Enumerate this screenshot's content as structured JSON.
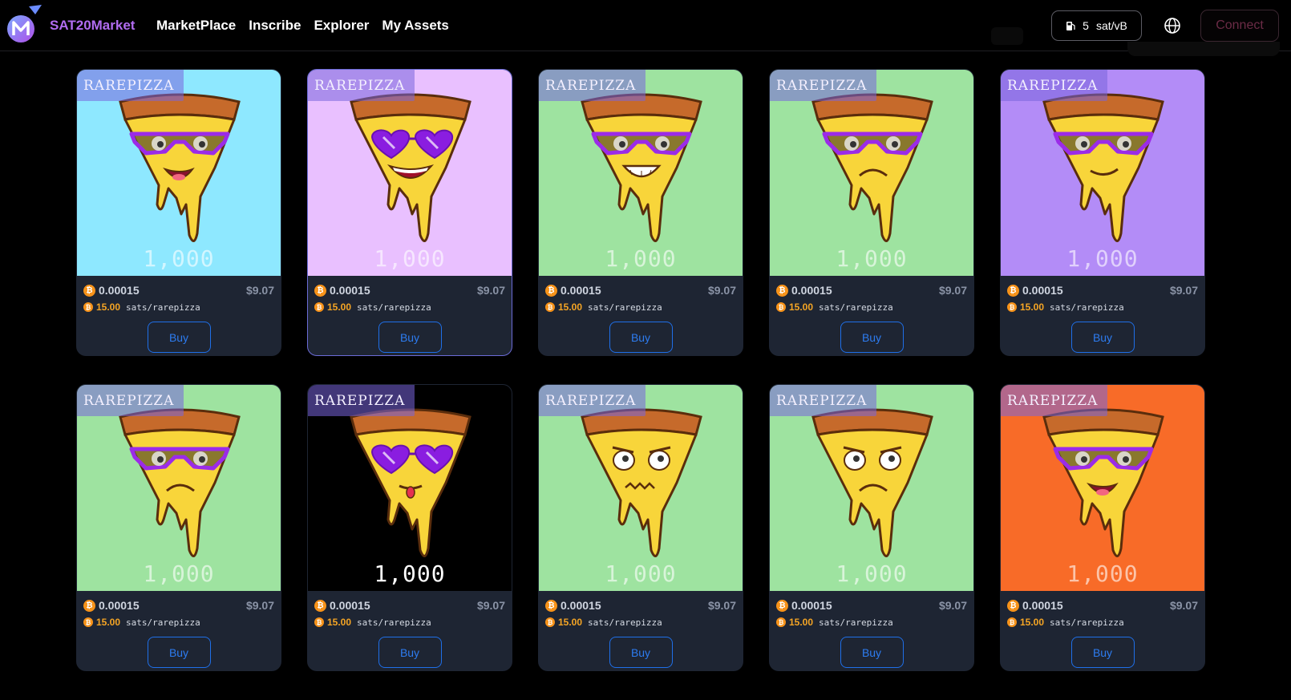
{
  "header": {
    "brand": "SAT20Market",
    "nav": [
      "MarketPlace",
      "Inscribe",
      "Explorer",
      "My Assets"
    ],
    "fee_value": "5",
    "fee_unit": "sat/vB",
    "connect_label": "Connect"
  },
  "colors": {
    "accent": "#b16cf0",
    "buy": "#2d7cf0",
    "rate": "#f5a524",
    "card": "#1e2533"
  },
  "icons": {
    "logo": "sat20-logo",
    "fee": "gas-pump-icon",
    "globe": "globe-icon",
    "coin": "bitcoin-icon"
  },
  "cards": [
    {
      "tag": "RAREPIZZA",
      "amount": "1,000",
      "price_btc": "0.00015",
      "price_usd": "$9.07",
      "rate": "15.00",
      "rate_unit": "sats/rarepizza",
      "buy": "Buy",
      "bg": "#8ee8ff",
      "mouth": "open",
      "glasses": "wide"
    },
    {
      "tag": "RAREPIZZA",
      "amount": "1,000",
      "price_btc": "0.00015",
      "price_usd": "$9.07",
      "rate": "15.00",
      "rate_unit": "sats/rarepizza",
      "buy": "Buy",
      "bg": "#e9c0ff",
      "mouth": "smile",
      "glasses": "heart"
    },
    {
      "tag": "RAREPIZZA",
      "amount": "1,000",
      "price_btc": "0.00015",
      "price_usd": "$9.07",
      "rate": "15.00",
      "rate_unit": "sats/rarepizza",
      "buy": "Buy",
      "bg": "#9ee3a0",
      "mouth": "grin",
      "glasses": "wide"
    },
    {
      "tag": "RAREPIZZA",
      "amount": "1,000",
      "price_btc": "0.00015",
      "price_usd": "$9.07",
      "rate": "15.00",
      "rate_unit": "sats/rarepizza",
      "buy": "Buy",
      "bg": "#9ee3a0",
      "mouth": "frown",
      "glasses": "wide"
    },
    {
      "tag": "RAREPIZZA",
      "amount": "1,000",
      "price_btc": "0.00015",
      "price_usd": "$9.07",
      "rate": "15.00",
      "rate_unit": "sats/rarepizza",
      "buy": "Buy",
      "bg": "#b38cf7",
      "mouth": "smirk",
      "glasses": "wide"
    },
    {
      "tag": "RAREPIZZA",
      "amount": "1,000",
      "price_btc": "0.00015",
      "price_usd": "$9.07",
      "rate": "15.00",
      "rate_unit": "sats/rarepizza",
      "buy": "Buy",
      "bg": "#9ee3a0",
      "mouth": "frown",
      "glasses": "wide"
    },
    {
      "tag": "RAREPIZZA",
      "amount": "1,000",
      "price_btc": "0.00015",
      "price_usd": "$9.07",
      "rate": "15.00",
      "rate_unit": "sats/rarepizza",
      "buy": "Buy",
      "bg": "#000000",
      "mouth": "tongue",
      "glasses": "heart"
    },
    {
      "tag": "RAREPIZZA",
      "amount": "1,000",
      "price_btc": "0.00015",
      "price_usd": "$9.07",
      "rate": "15.00",
      "rate_unit": "sats/rarepizza",
      "buy": "Buy",
      "bg": "#9ee3a0",
      "mouth": "zigzag",
      "glasses": "none"
    },
    {
      "tag": "RAREPIZZA",
      "amount": "1,000",
      "price_btc": "0.00015",
      "price_usd": "$9.07",
      "rate": "15.00",
      "rate_unit": "sats/rarepizza",
      "buy": "Buy",
      "bg": "#9ee3a0",
      "mouth": "frown",
      "glasses": "none"
    },
    {
      "tag": "RAREPIZZA",
      "amount": "1,000",
      "price_btc": "0.00015",
      "price_usd": "$9.07",
      "rate": "15.00",
      "rate_unit": "sats/rarepizza",
      "buy": "Buy",
      "bg": "#f86b28",
      "mouth": "open",
      "glasses": "wide"
    }
  ]
}
